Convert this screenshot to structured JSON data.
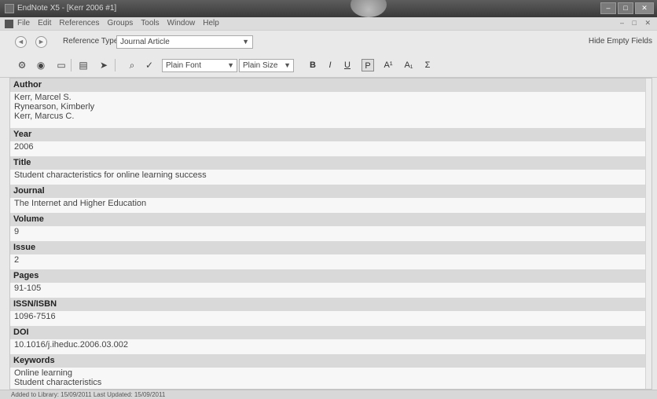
{
  "window": {
    "title": "EndNote X5 - [Kerr 2006 #1]",
    "controls": [
      "–",
      "□",
      "✕"
    ]
  },
  "menubar": {
    "items": [
      "File",
      "Edit",
      "References",
      "Groups",
      "Tools",
      "Window",
      "Help"
    ],
    "mdi_controls": "– □ ✕"
  },
  "toolbar1": {
    "back_label": "◄",
    "forward_label": "►",
    "reference_type_label": "Reference Type:",
    "reference_type_value": "Journal Article",
    "hide_empty_fields": "Hide Empty Fields"
  },
  "toolbar2": {
    "font_value": "Plain Font",
    "size_value": "Plain Size",
    "bold": "B",
    "italic": "I",
    "underline": "U",
    "plain": "P",
    "superscript": "A¹",
    "subscript": "A₁",
    "symbol": "Σ"
  },
  "fields": [
    {
      "label": "Author",
      "lines": [
        "Kerr, Marcel S.",
        "Rynearson, Kimberly",
        "Kerr, Marcus C."
      ]
    },
    {
      "label": "Year",
      "lines": [
        "2006"
      ]
    },
    {
      "label": "Title",
      "lines": [
        "Student characteristics for online learning success"
      ]
    },
    {
      "label": "Journal",
      "lines": [
        "The Internet and Higher Education"
      ]
    },
    {
      "label": "Volume",
      "lines": [
        "9"
      ]
    },
    {
      "label": "Issue",
      "lines": [
        "2"
      ]
    },
    {
      "label": "Pages",
      "lines": [
        "91-105"
      ]
    },
    {
      "label": "ISSN/ISBN",
      "lines": [
        "1096-7516"
      ]
    },
    {
      "label": "DOI",
      "lines": [
        "10.1016/j.iheduc.2006.03.002"
      ]
    },
    {
      "label": "Keywords",
      "lines": [
        "Online learning",
        "Student characteristics"
      ]
    }
  ],
  "statusbar": {
    "text": "Added to Library: 15/09/2011   Last Updated: 15/09/2011"
  }
}
